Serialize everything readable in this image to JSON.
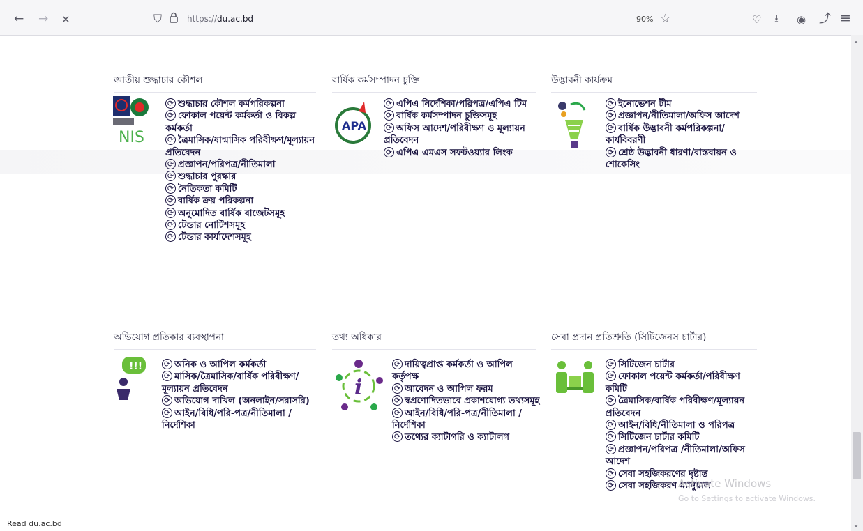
{
  "browser": {
    "back_icon": "←",
    "forward_icon": "→",
    "close_icon": "✕",
    "shield_icon": "⛉",
    "lock_icon": "🔒",
    "url_prefix": "https://",
    "url_host": "du.ac.bd",
    "zoom": "90%",
    "star_icon": "☆",
    "pocket_icon": "♡",
    "download_icon": "⭳",
    "account_icon": "◉",
    "extensions_icon": "⤴",
    "menu_icon": "≡"
  },
  "sections": [
    {
      "heading": "জাতীয় শুদ্ধাচার কৌশল",
      "icon": "nis-logo-icon",
      "items": [
        "শুদ্ধাচার কৌশল কর্মপরিকল্পনা",
        "ফোকাল পয়েন্ট কর্মকর্তা ও বিকল্প কর্মকর্তা",
        "ত্রৈমাসিক/ষান্মাসিক পরিবীক্ষণ/মূল্যায়ন প্রতিবেদন",
        "প্রজ্ঞাপন/পরিপত্র/নীতিমালা",
        "শুদ্ধাচার পুরস্কার",
        "নৈতিকতা কমিটি",
        "বার্ষিক ক্রয় পরিকল্পনা",
        "অনুমোদিত বার্ষিক বাজেটসমূহ",
        "টেন্ডার নোটিশসমূহ",
        "টেন্ডার কার্যাদেশসমূহ"
      ]
    },
    {
      "heading": "বার্ষিক কর্মসম্পাদন চুক্তি",
      "icon": "apa-logo-icon",
      "icon_text": "APA",
      "items": [
        "এপিএ নির্দেশিকা/পরিপত্র/এপিএ টিম",
        "বার্ষিক কর্মসম্পাদন চুক্তিসমূহ",
        "অফিস আদেশ/পরিবীক্ষণ ও মূল্যায়ন প্রতিবেদন",
        "এপিএ এমএস সফটওয়্যার লিংক"
      ]
    },
    {
      "heading": "উদ্ভাবনী কার্যক্রম",
      "icon": "innovation-bulb-icon",
      "items": [
        "ইনোভেশন টীম",
        "প্রজ্ঞাপন/নীতিমালা/অফিস আদেশ",
        "বার্ষিক উদ্ভাবনী কর্মপরিকল্পনা/কার্যবিবরণী",
        "শ্রেষ্ঠ উদ্ভাবনী ধারণা/বাস্তবায়ন ও শোকেসিং"
      ]
    },
    {
      "heading": "অভিযোগ প্রতিকার ব্যবস্থাপনা",
      "icon": "grievance-speaker-icon",
      "items": [
        "অনিক ও আপিল কর্মকর্তা",
        "মাসিক/ত্রৈমাসিক/বার্ষিক পরিবীক্ষণ/মূল্যায়ন প্রতিবেদন",
        "অভিযোগ দাখিল (অনলাইন/সরাসরি)",
        "আইন/বিধি/পরি-পত্র/নীতিমালা /নির্দেশিকা"
      ]
    },
    {
      "heading": "তথ্য অধিকার",
      "icon": "information-people-icon",
      "items": [
        "দায়িত্বপ্রাপ্ত কর্মকর্তা ও আপিল কর্তৃপক্ষ",
        "আবেদন ও আপিল ফরম",
        "স্বপ্রণোদিতভাবে প্রকাশযোগ্য তথ্যসমূহ",
        "আইন/বিধি/পরি-পত্র/নীতিমালা /নির্দেশিকা",
        "তথ্যের ক্যাটাগরি ও ক্যাটালগ"
      ]
    },
    {
      "heading": "সেবা প্রদান প্রতিশ্রুতি (সিটিজেনস চার্টার)",
      "icon": "citizen-charter-icon",
      "items": [
        "সিটিজেন চার্টার",
        "ফোকাল পয়েন্ট কর্মকর্তা/পরিবীক্ষণ কমিটি",
        "ত্রৈমাসিক/বার্ষিক পরিবীক্ষণ/মূল্যায়ন প্রতিবেদন",
        "আইন/বিধি/নীতিমালা ও পরিপত্র",
        "সিটিজেন চার্টার কমিটি",
        "প্রজ্ঞাপন/পরিপত্র /নীতিমালা/অফিস আদেশ",
        "সেবা সহজিকরণের দৃষ্টান্ত",
        "সেবা সহজিকরণ ম্যানুয়াল"
      ]
    }
  ],
  "status_bar": "Read du.ac.bd",
  "watermark": {
    "line1": "Activate Windows",
    "line2": "Go to Settings to activate Windows."
  },
  "scroll_up_icon": "⌃",
  "scroll_down_icon": "⌄"
}
